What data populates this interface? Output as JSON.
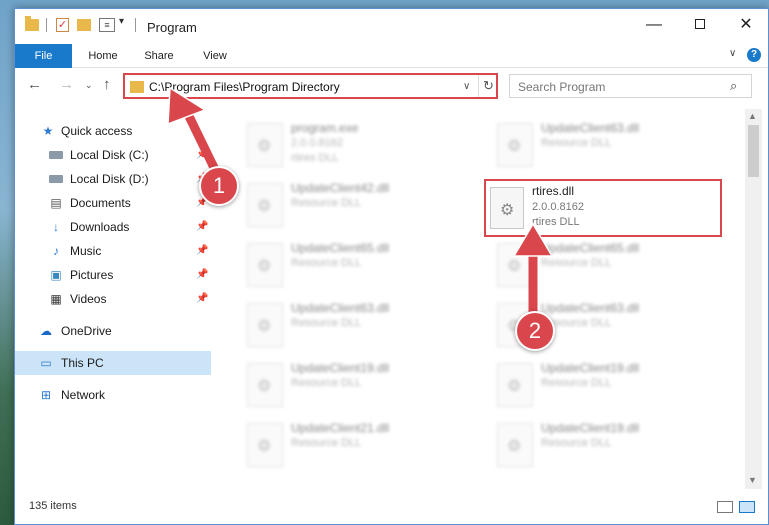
{
  "window": {
    "title": "Program",
    "minimize": "—",
    "close": "✕"
  },
  "ribbon": {
    "tabs": [
      "File",
      "Home",
      "Share",
      "View"
    ]
  },
  "navigation": {
    "back": "←",
    "forward": "→",
    "recent": "⌄",
    "up": "↑",
    "address_path": "C:\\Program Files\\Program Directory",
    "refresh": "↻",
    "search_placeholder": "Search Program"
  },
  "sidebar": {
    "items": [
      {
        "label": "Quick access",
        "icon": "star-icon",
        "pinned": false
      },
      {
        "label": "Local Disk (C:)",
        "icon": "drive-icon",
        "pinned": true
      },
      {
        "label": "Local Disk (D:)",
        "icon": "drive-icon",
        "pinned": true
      },
      {
        "label": "Documents",
        "icon": "documents-icon",
        "pinned": true
      },
      {
        "label": "Downloads",
        "icon": "downloads-icon",
        "pinned": true
      },
      {
        "label": "Music",
        "icon": "music-icon",
        "pinned": true
      },
      {
        "label": "Pictures",
        "icon": "pictures-icon",
        "pinned": true
      },
      {
        "label": "Videos",
        "icon": "videos-icon",
        "pinned": true
      },
      {
        "label": "OneDrive",
        "icon": "cloud-icon",
        "pinned": false
      },
      {
        "label": "This PC",
        "icon": "pc-icon",
        "pinned": false,
        "selected": true
      },
      {
        "label": "Network",
        "icon": "network-icon",
        "pinned": false
      }
    ]
  },
  "files": {
    "left_column": [
      {
        "name": "program.exe",
        "version": "2.0.0.8162",
        "type": "rtires DLL"
      },
      {
        "name": "UpdateClient42.dll",
        "version": "",
        "type": "Resource DLL"
      },
      {
        "name": "UpdateClient65.dll",
        "version": "",
        "type": "Resource DLL"
      },
      {
        "name": "UpdateClient63.dll",
        "version": "",
        "type": "Resource DLL"
      },
      {
        "name": "UpdateClient19.dll",
        "version": "",
        "type": "Resource DLL"
      },
      {
        "name": "UpdateClient21.dll",
        "version": "",
        "type": "Resource DLL"
      }
    ],
    "right_column": [
      {
        "name": "UpdateClient63.dll",
        "version": "",
        "type": "Resource DLL"
      },
      {
        "name": "UpdateClient65.dll",
        "version": "",
        "type": "Resource DLL"
      },
      {
        "name": "UpdateClient63.dll",
        "version": "",
        "type": "Resource DLL"
      },
      {
        "name": "UpdateClient19.dll",
        "version": "",
        "type": "Resource DLL"
      },
      {
        "name": "UpdateClient19.dll",
        "version": "",
        "type": "Resource DLL"
      }
    ],
    "highlighted": {
      "name": "rtires.dll",
      "version": "2.0.0.8162",
      "type": "rtires DLL"
    }
  },
  "status": {
    "item_count": "135 items"
  },
  "annotations": {
    "callout_1": "1",
    "callout_2": "2",
    "color": "#d9464c"
  }
}
